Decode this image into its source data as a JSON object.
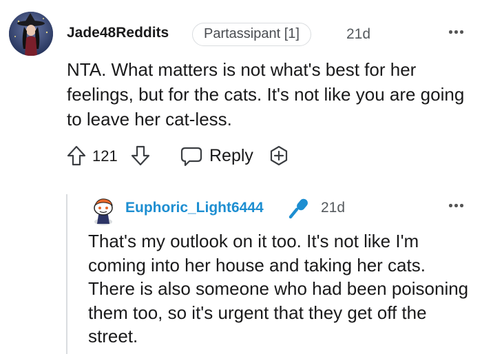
{
  "comment": {
    "username": "Jade48Reddits",
    "flair": "Partassipant [1]",
    "time": "21d",
    "body": "NTA. What matters is not what's best for her feelings, but for the cats. It's not like you are going to leave her cat-less.",
    "score": "121",
    "reply_label": "Reply",
    "icons": {
      "more": "more-options-icon",
      "upvote": "upvote-arrow-icon",
      "downvote": "downvote-arrow-icon",
      "reply": "speech-bubble-icon",
      "award": "award-plus-icon"
    }
  },
  "reply": {
    "username": "Euphoric_Light6444",
    "time": "21d",
    "body": "That's my outlook on it too. It's not like I'm coming into her house and taking her cats. There is also someone who had been poisoning them too, so it's urgent that they get off the street.",
    "icons": {
      "op_badge": "microphone-icon",
      "more": "more-options-icon"
    }
  },
  "colors": {
    "reply_username": "#1d8ed1",
    "op_badge": "#1d8ed1",
    "muted_text": "#555a5e",
    "border": "#d9dcdf"
  }
}
